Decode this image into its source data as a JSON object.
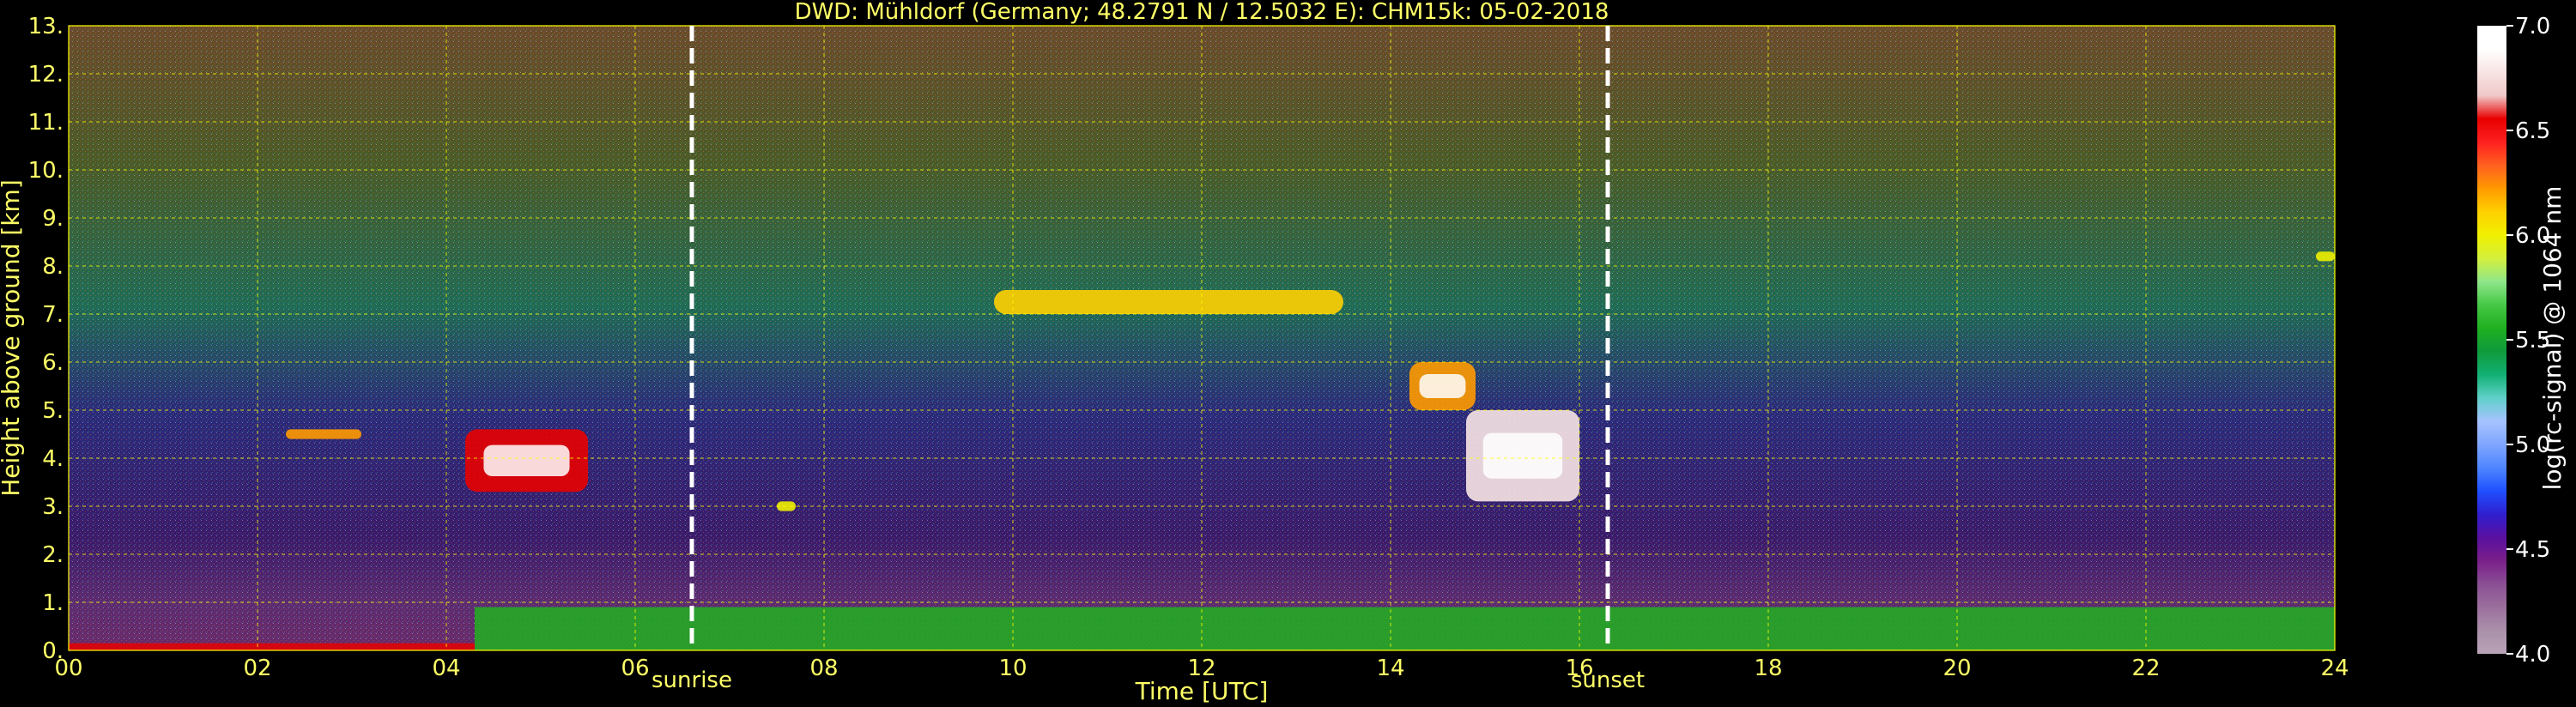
{
  "chart_data": {
    "type": "heatmap",
    "title": "DWD: Mühldorf (Germany; 48.2791 N / 12.5032 E):    CHM15k: 05-02-2018",
    "xlabel": "Time [UTC]",
    "ylabel": "Height above ground [km]",
    "xlim": [
      0,
      24
    ],
    "ylim": [
      0,
      13
    ],
    "x_ticks": [
      "00",
      "02",
      "04",
      "06",
      "08",
      "10",
      "12",
      "14",
      "16",
      "18",
      "20",
      "22",
      "24"
    ],
    "y_ticks": [
      "0.",
      "1.",
      "2.",
      "3.",
      "4.",
      "5.",
      "6.",
      "7.",
      "8.",
      "9.",
      "10.",
      "11.",
      "12.",
      "13."
    ],
    "grid": true,
    "grid_color": "#ffff00",
    "events": [
      {
        "label": "sunrise",
        "time": 6.6
      },
      {
        "label": "sunset",
        "time": 16.3
      }
    ],
    "colorbar": {
      "label": "log(rc-signal) @ 1064 nm",
      "range": [
        4.0,
        7.0
      ],
      "ticks": [
        "4.0",
        "4.5",
        "5.0",
        "5.5",
        "6.0",
        "6.5",
        "7.0"
      ],
      "colors": [
        "#b9a3b7",
        "#aa90aa",
        "#9b6f9c",
        "#8a4f93",
        "#7a1f8a",
        "#5a10a0",
        "#2f1fcf",
        "#1f50ff",
        "#4f86ff",
        "#7fa6ff",
        "#a6c2ff",
        "#5fd0c8",
        "#12b074",
        "#0f9a3c",
        "#20b020",
        "#46c846",
        "#8ee68a",
        "#d4f03c",
        "#f0f000",
        "#ffd000",
        "#ff9a00",
        "#ff6020",
        "#ff2020",
        "#e80000",
        "#f0c8c8",
        "#f8e4e4",
        "#ffffff",
        "#ffffff"
      ]
    },
    "features": [
      {
        "name": "boundary layer",
        "t_start": 4.3,
        "t_end": 24,
        "z_bottom": 0,
        "z_top": 0.9,
        "signal": 5.5
      },
      {
        "name": "low layer",
        "t_start": 0,
        "t_end": 4.3,
        "z_bottom": 0,
        "z_top": 0.15,
        "signal": 6.5
      },
      {
        "name": "cloud",
        "t_start": 4.2,
        "t_end": 5.5,
        "z_bottom": 3.3,
        "z_top": 4.6,
        "signal": 6.5
      },
      {
        "name": "cloud",
        "t_start": 2.3,
        "t_end": 3.1,
        "z_bottom": 4.4,
        "z_top": 4.6,
        "signal": 6.2
      },
      {
        "name": "cloud",
        "t_start": 7.5,
        "t_end": 7.7,
        "z_bottom": 2.9,
        "z_top": 3.1,
        "signal": 6.0
      },
      {
        "name": "cloud",
        "t_start": 14.8,
        "t_end": 16.0,
        "z_bottom": 3.1,
        "z_top": 5.0,
        "signal": 6.8
      },
      {
        "name": "cloud",
        "t_start": 14.2,
        "t_end": 14.9,
        "z_bottom": 5.0,
        "z_top": 6.0,
        "signal": 6.2
      },
      {
        "name": "cloud",
        "t_start": 9.8,
        "t_end": 13.5,
        "z_bottom": 7.0,
        "z_top": 7.5,
        "signal": 6.1
      },
      {
        "name": "cloud",
        "t_start": 23.8,
        "t_end": 24.0,
        "z_bottom": 8.1,
        "z_top": 8.3,
        "signal": 6.0
      }
    ]
  }
}
